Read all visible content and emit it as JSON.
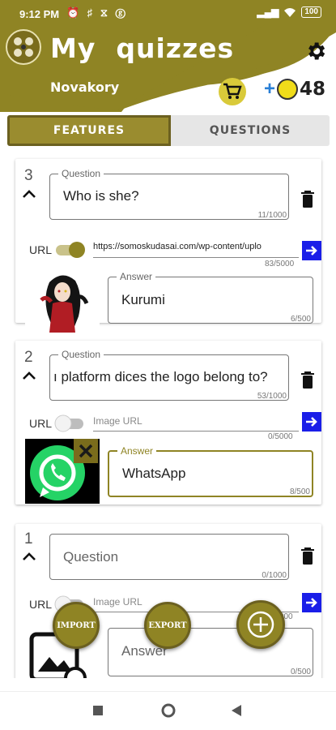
{
  "status": {
    "time": "9:12 PM",
    "icons": "⏰ ♯ ⧖ ⓖ",
    "signal": "▂▄▆",
    "battery": "100"
  },
  "header": {
    "title": "My  quizzes",
    "username": "Novakory",
    "coins_plus": "+",
    "coins": "48",
    "brand_color": "#8f8424"
  },
  "tabs": [
    {
      "label": "FEATURES",
      "active": true
    },
    {
      "label": "QUESTIONS",
      "active": false
    }
  ],
  "cards": [
    {
      "number": "3",
      "question_label": "Question",
      "question": "Who is she?",
      "question_counter": "11/1000",
      "url_label": "URL",
      "url_toggle": "on",
      "url_value": "https://somoskudasai.com/wp-content/uplo",
      "url_counter": "83/5000",
      "answer_label": "Answer",
      "answer": "Kurumi",
      "answer_counter": "6/500",
      "image": "anime-girl"
    },
    {
      "number": "2",
      "question_label": "Question",
      "question": "ı platform dices the logo belong to?",
      "question_counter": "53/1000",
      "url_label": "URL",
      "url_toggle": "off",
      "url_placeholder": "Image URL",
      "url_counter": "0/5000",
      "answer_label": "Answer",
      "answer": "WhatsApp",
      "answer_counter": "8/500",
      "image": "whatsapp-logo"
    },
    {
      "number": "1",
      "question_placeholder": "Question",
      "question_counter": "0/1000",
      "url_label": "URL",
      "url_toggle": "off",
      "url_placeholder": "Image URL",
      "url_counter": "0/5000",
      "answer_placeholder": "Answer",
      "answer_counter": "0/500",
      "image": "image-placeholder"
    }
  ],
  "fabs": {
    "import_label": "IMPORT",
    "export_label": "EXPORT",
    "add_icon": "plus-circle-icon"
  }
}
